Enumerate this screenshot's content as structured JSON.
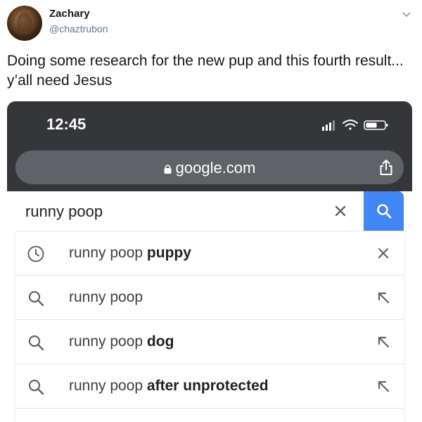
{
  "tweet": {
    "display_name": "Zachary",
    "handle": "@chaztrubon",
    "text": "Doing some research for the new pup and this fourth result... y’all need Jesus"
  },
  "phone": {
    "status": {
      "time": "12:45"
    },
    "url": "google.com",
    "search": {
      "query": "runny poop"
    },
    "suggestions": [
      {
        "icon": "history-icon",
        "prefix": "runny poop ",
        "bold": "puppy",
        "trail_icon": "remove-icon"
      },
      {
        "icon": "search-icon",
        "prefix": "runny poop",
        "bold": "",
        "trail_icon": "fill-query-arrow-icon"
      },
      {
        "icon": "search-icon",
        "prefix": "runny poop ",
        "bold": "dog",
        "trail_icon": "fill-query-arrow-icon"
      },
      {
        "icon": "search-icon",
        "prefix": "runny poop ",
        "bold": "after unprotected",
        "trail_icon": "fill-query-arrow-icon"
      }
    ]
  },
  "colors": {
    "toolbar": "#35363a",
    "url_bar": "#5f6368",
    "search_button": "#4285f4",
    "handle": "#657786"
  }
}
